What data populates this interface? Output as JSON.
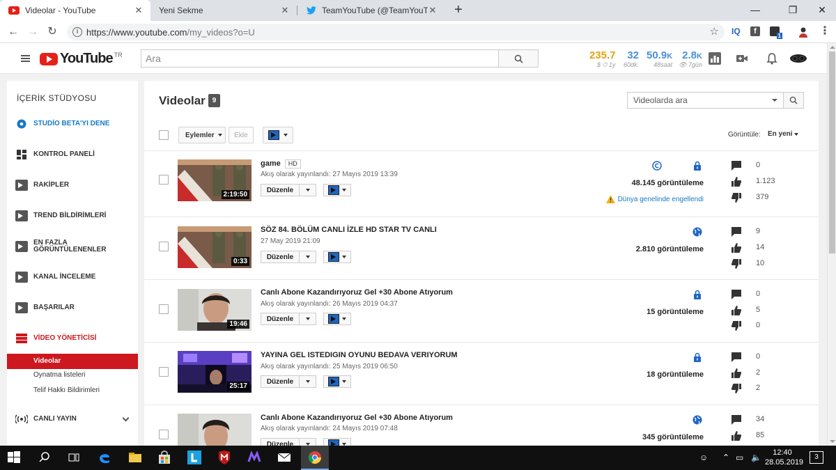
{
  "browser": {
    "tabs": [
      {
        "title": "Videolar - YouTube",
        "icon": "youtube-icon"
      },
      {
        "title": "Yeni Sekme",
        "icon": "none"
      },
      {
        "title": "TeamYouTube (@TeamYouTube) | Tw",
        "icon": "twitter-icon"
      }
    ],
    "url_host": "https://www.youtube.com",
    "url_path": "/my_videos?o=U",
    "ext_iq": "IQ",
    "ext_badge": "1"
  },
  "yt": {
    "logo_text": "YouTube",
    "region": "TR",
    "search_placeholder": "Ara",
    "stats": [
      {
        "value": "235.7",
        "sub": "$ ⏱ 1y",
        "color": "#e0a315"
      },
      {
        "value": "32",
        "sub": "60dk.",
        "color": "#4a90d9"
      },
      {
        "value": "50.9",
        "unit": "K",
        "sub": "48saat",
        "color": "#4a90d9"
      },
      {
        "value": "2.8",
        "unit": "K",
        "sub": "👁 7gün",
        "color": "#4a90d9"
      }
    ]
  },
  "sidebar": {
    "title": "İÇERİK STÜDYOSU",
    "items": [
      {
        "label": "STUDİO BETA'YI DENE",
        "icon": "gear-icon"
      },
      {
        "label": "KONTROL PANELİ",
        "icon": "dashboard-icon"
      },
      {
        "label": "RAKİPLER",
        "icon": "vidiq-icon"
      },
      {
        "label": "TREND BİLDİRİMLERİ",
        "icon": "vidiq-icon"
      },
      {
        "label": "EN FAZLA\nGÖRÜNTÜLENENLER",
        "icon": "vidiq-icon"
      },
      {
        "label": "KANAL İNCELEME",
        "icon": "vidiq-icon"
      },
      {
        "label": "BAŞARILAR",
        "icon": "vidiq-icon"
      },
      {
        "label": "VİDEO YÖNETİCİSİ",
        "icon": "video-manager-icon"
      }
    ],
    "subitems": [
      "Videolar",
      "Oynatma listeleri",
      "Telif Hakkı Bildirimleri"
    ],
    "live": "CANLI YAYIN"
  },
  "main": {
    "title": "Videolar",
    "count": "9",
    "search_placeholder": "Videolarda ara",
    "actions_label": "Eylemler",
    "add_label": "Ekle",
    "sort_label": "Görüntüle:",
    "sort_value": "En yeni",
    "edit_label": "Düzenle",
    "blocked_text": "Dünya genelinde engellendi",
    "videos": [
      {
        "title": "game",
        "hd": "HD",
        "date": "Akış olarak yayınlandı: 27 Mayıs 2019 13:39",
        "duration": "2:19:50",
        "views": "48.145 görüntüleme",
        "comments": "0",
        "likes": "1.123",
        "dislikes": "379",
        "privacy": "private",
        "copyright": true,
        "blocked": true,
        "thumb": "soldiers"
      },
      {
        "title": "SÖZ 84. BÖLÜM CANLI İZLE HD STAR TV CANLI",
        "date": "27 May 2019 21:09",
        "duration": "0:33",
        "views": "2.810 görüntüleme",
        "comments": "9",
        "likes": "14",
        "dislikes": "10",
        "privacy": "public",
        "thumb": "soldiers"
      },
      {
        "title": "Canlı Abone Kazandırıyoruz Gel +30 Abone Atıyorum",
        "date": "Akış olarak yayınlandı: 26 Mayıs 2019 04:37",
        "duration": "19:46",
        "views": "15 görüntüleme",
        "comments": "0",
        "likes": "5",
        "dislikes": "0",
        "privacy": "private",
        "thumb": "face"
      },
      {
        "title": "YAYINA GEL ISTEDIGIN OYUNU BEDAVA VERIYORUM",
        "date": "Akış olarak yayınlandı: 25 Mayıs 2019 06:50",
        "duration": "25:17",
        "views": "18 görüntüleme",
        "comments": "0",
        "likes": "2",
        "dislikes": "2",
        "privacy": "private",
        "thumb": "neon"
      },
      {
        "title": "Canlı Abone Kazandırıyoruz Gel +30 Abone Atıyorum",
        "date": "Akış olarak yayınlandı: 24 Mayıs 2019 07:48",
        "duration": "",
        "views": "345 görüntüleme",
        "comments": "34",
        "likes": "85",
        "dislikes": "",
        "privacy": "public",
        "thumb": "face"
      }
    ]
  },
  "taskbar": {
    "time": "12:40",
    "date": "28.05.2019",
    "notif": "3"
  }
}
